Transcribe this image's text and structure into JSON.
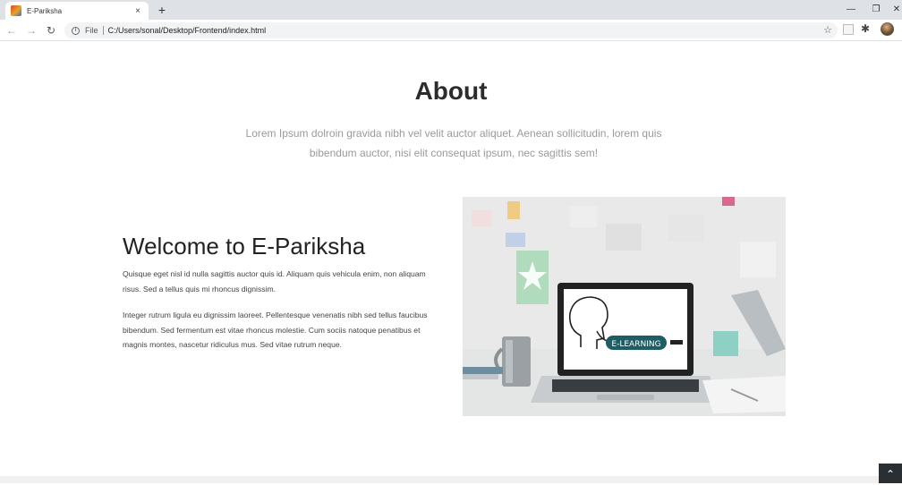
{
  "browser": {
    "tab_title": "E-Pariksha",
    "close_glyph": "×",
    "new_tab_glyph": "+",
    "scheme_label": "File",
    "url": "C:/Users/sonal/Desktop/Frontend/index.html",
    "icons": [
      "favicon",
      "close-icon",
      "plus-icon",
      "back-arrow-icon",
      "forward-arrow-icon",
      "reload-icon",
      "info-icon",
      "star-icon",
      "extension-icon",
      "puzzle-icon",
      "avatar",
      "minimize-icon",
      "maximize-icon"
    ]
  },
  "about": {
    "title": "About",
    "description": "Lorem Ipsum dolroin gravida nibh vel velit auctor aliquet. Aenean sollicitudin, lorem quis bibendum auctor, nisi elit consequat ipsum, nec sagittis sem!"
  },
  "welcome": {
    "title": "Welcome to E-Pariksha",
    "paragraph1": "Quisque eget nisl id nulla sagittis auctor quis id. Aliquam quis vehicula enim, non aliquam risus. Sed a tellus quis mi rhoncus dignissim.",
    "paragraph2": "Integer rutrum ligula eu dignissim laoreet. Pellentesque venenatis nibh sed tellus faucibus bibendum. Sed fermentum est vitae rhoncus molestie. Cum sociis natoque penatibus et magnis montes, nascetur ridiculus mus. Sed vitae rutrum neque."
  },
  "image": {
    "badge_text": "E-LEARNING"
  },
  "colors": {
    "badge": "#1d5e66",
    "heading": "#2c2c2c",
    "muted": "#9a9a9a",
    "scroll_button": "#2a2f34"
  }
}
